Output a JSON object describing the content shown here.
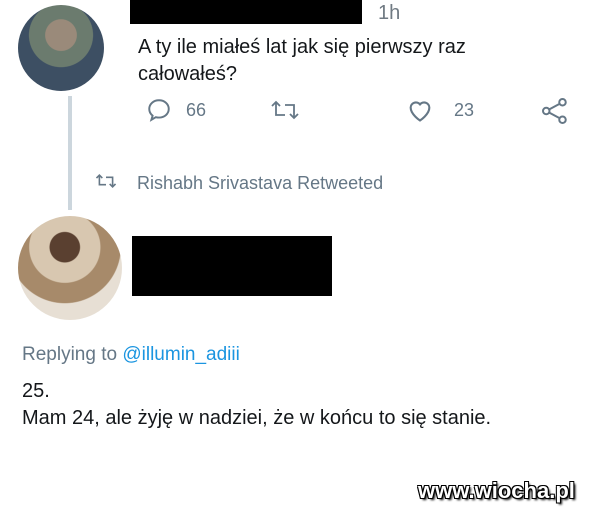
{
  "tweet": {
    "time": "1h",
    "text_line1": "A ty ile miałeś lat jak się pierwszy raz",
    "text_line2": "całowałeś?",
    "reply_count": "66",
    "like_count": "23"
  },
  "retweet_notice": {
    "label": "Rishabh Srivastava Retweeted"
  },
  "reply": {
    "replying_prefix": "Replying to",
    "replying_mention": "@illumin_adiii",
    "line1": "25.",
    "line2": "Mam 24, ale żyję w nadziei, że w końcu to się stanie."
  },
  "watermark": "www.wiocha.pl",
  "colors": {
    "text": "#14171a",
    "secondary": "#657786",
    "link": "#1b95e0",
    "thread_line": "#ccd6dd"
  },
  "icons": [
    "reply-icon",
    "retweet-icon",
    "like-icon",
    "share-icon"
  ]
}
